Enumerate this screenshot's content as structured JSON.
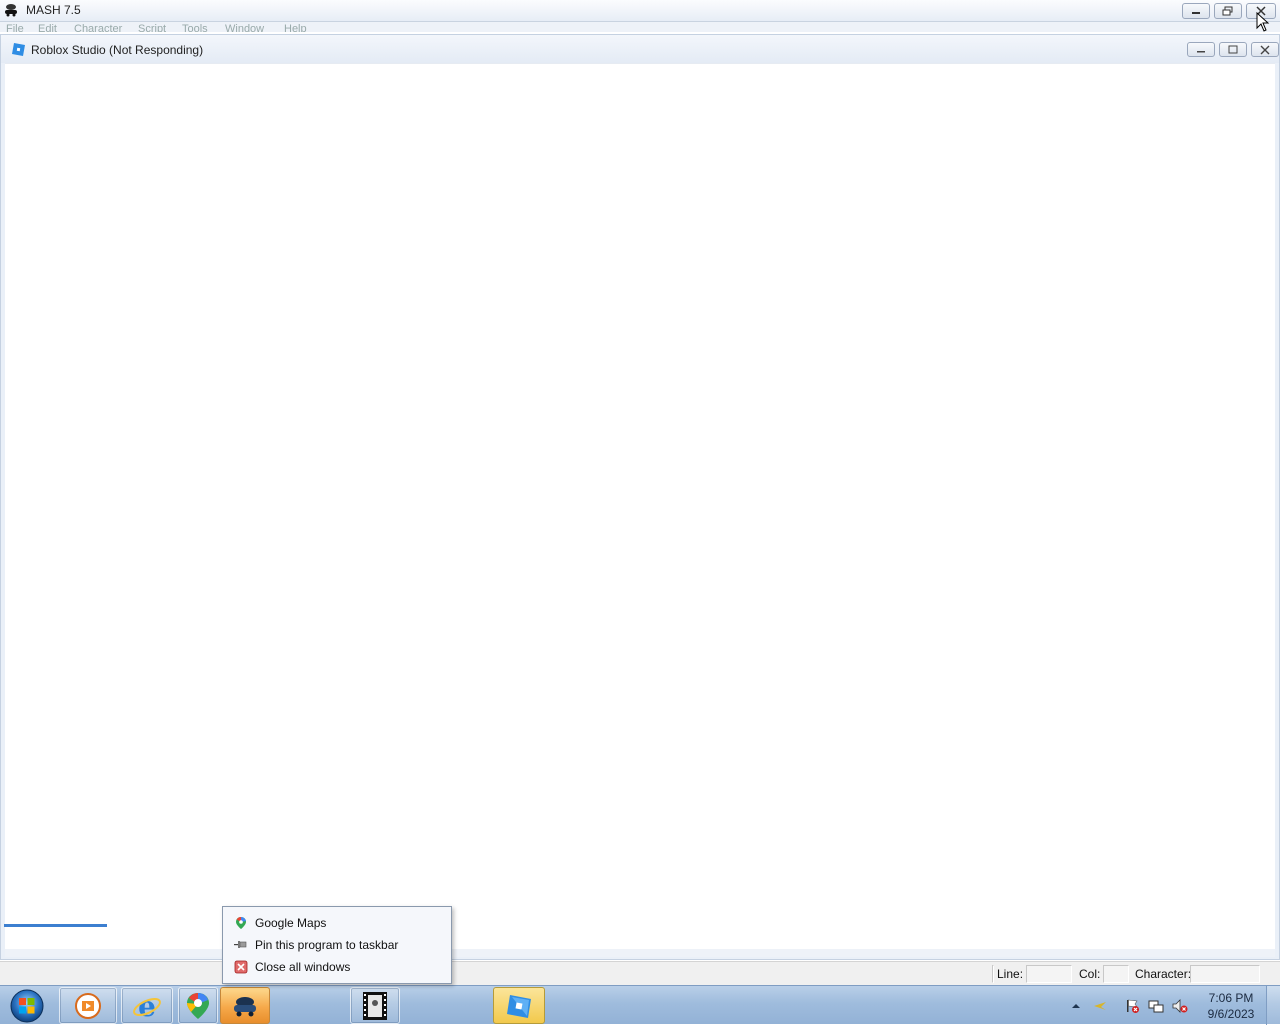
{
  "mash_window": {
    "title": "MASH 7.5",
    "menu": [
      "File",
      "Edit",
      "Character",
      "Script",
      "Tools",
      "Window",
      "Help"
    ]
  },
  "roblox_window": {
    "title": "Roblox Studio (Not Responding)"
  },
  "statusbar": {
    "line_label": "Line:",
    "col_label": "Col:",
    "character_label": "Character:"
  },
  "jumplist": {
    "items": [
      {
        "label": "Google Maps",
        "icon": "google-maps-icon"
      },
      {
        "label": "Pin this program to taskbar",
        "icon": "pin-icon"
      },
      {
        "label": "Close all windows",
        "icon": "close-windows-icon"
      }
    ]
  },
  "taskbar": {
    "apps": [
      "windows-media-player",
      "internet-explorer",
      "google-maps",
      "mash",
      "film-app",
      "roblox-studio"
    ],
    "clock_time": "7:06 PM",
    "clock_date": "9/6/2023"
  },
  "colors": {
    "taskbar": "#9fbcdd",
    "active_button": "#f6a94a",
    "accent_progress": "#3c7fd0"
  }
}
